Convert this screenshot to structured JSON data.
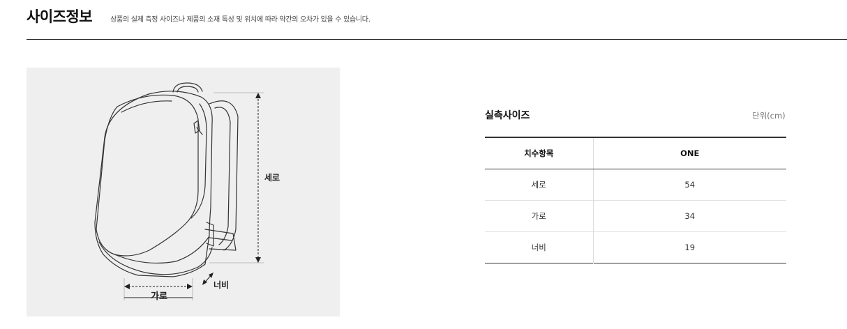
{
  "header": {
    "title": "사이즈정보",
    "description": "상품의 실제 측정 사이즈나 제품의 소재 특성 및 위치에 따라 약간의 오차가 있을 수 있습니다."
  },
  "illustration": {
    "icon": "backpack-diagram-icon",
    "labels": {
      "height": "세로",
      "width": "가로",
      "depth": "너비"
    }
  },
  "size_table": {
    "title": "실측사이즈",
    "unit": "단위(cm)",
    "headers": [
      "치수항목",
      "ONE"
    ],
    "rows": [
      {
        "label": "세로",
        "value": "54"
      },
      {
        "label": "가로",
        "value": "34"
      },
      {
        "label": "너비",
        "value": "19"
      }
    ]
  }
}
